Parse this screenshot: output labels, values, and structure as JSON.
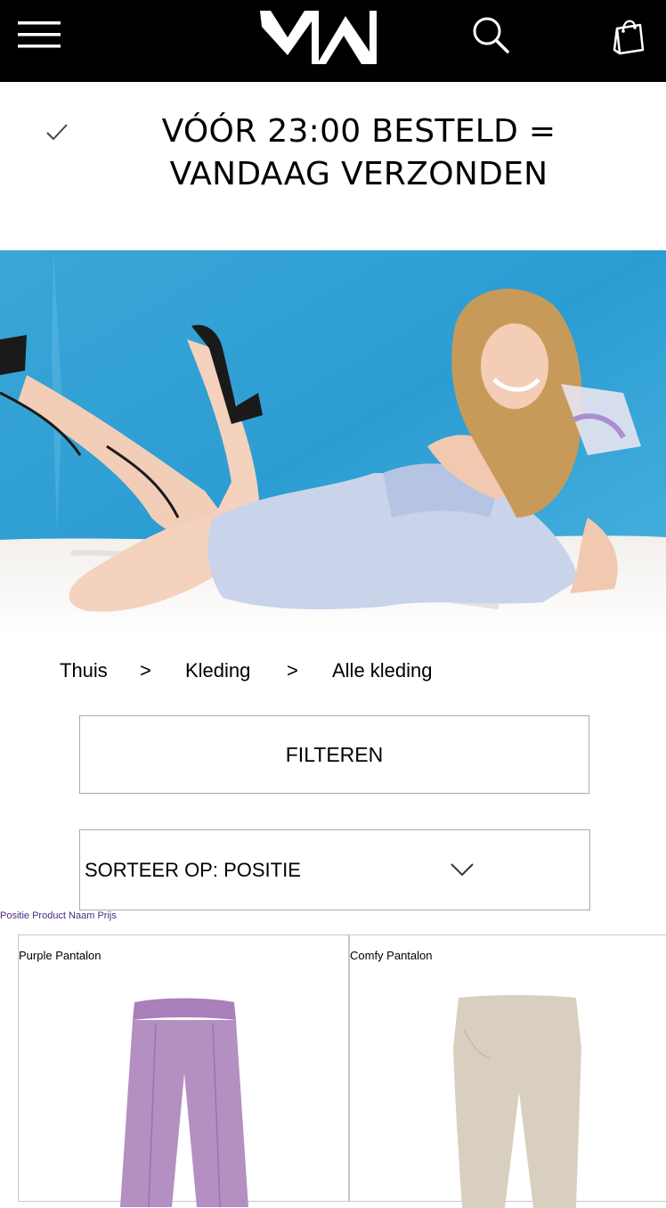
{
  "header": {
    "menu_icon": "hamburger-menu-icon",
    "logo": "MW",
    "search_icon": "search-icon",
    "cart_icon": "shopping-bag-icon",
    "background": "#000000"
  },
  "shipping_banner": {
    "icon": "check-icon",
    "text": "VÓÓR 23:00 BESTELD = VANDAAG VERZONDEN"
  },
  "breadcrumb": {
    "items": [
      "Thuis",
      "Kleding",
      "Alle kleding"
    ],
    "separator": ">"
  },
  "filter": {
    "label": "FILTEREN"
  },
  "sort": {
    "label": "SORTEER OP: POSITIE",
    "icon": "chevron-down-icon",
    "options": [
      "Positie",
      "Product Naam",
      "Prijs"
    ]
  },
  "products": [
    {
      "name": "Purple Pantalon",
      "color": "#b48fc2"
    },
    {
      "name": "Comfy Pantalon",
      "color": "#d9cfc1"
    }
  ]
}
